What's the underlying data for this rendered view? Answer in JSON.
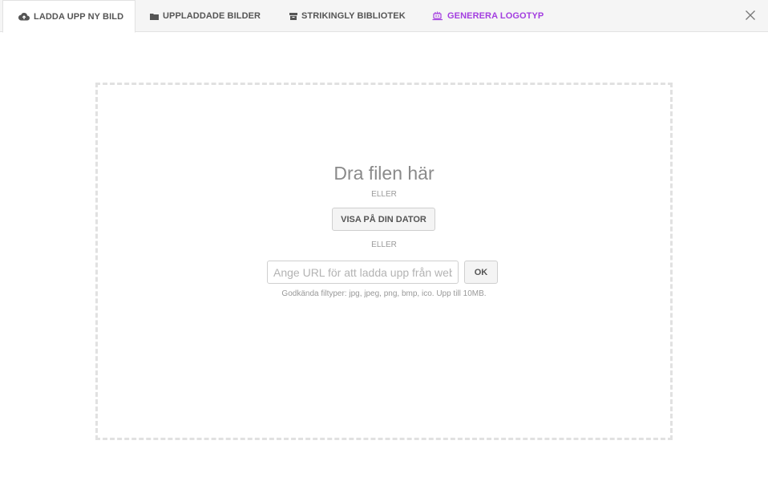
{
  "tabs": [
    {
      "label": "LADDA UPP NY BILD",
      "icon": "cloud-upload-icon",
      "active": true
    },
    {
      "label": "UPPLADDADE BILDER",
      "icon": "folder-icon",
      "active": false
    },
    {
      "label": "STRIKINGLY BIBLIOTEK",
      "icon": "archive-box-icon",
      "active": false
    },
    {
      "label": "GENERERA LOGOTYP",
      "icon": "logo-generator-icon",
      "active": false,
      "color": "#a33ee0"
    }
  ],
  "close_icon": "close-icon",
  "upload": {
    "drop_title": "Dra filen här",
    "or_1": "ELLER",
    "browse_label": "VISA PÅ DIN DATOR",
    "or_2": "ELLER",
    "url_placeholder": "Ange URL för att ladda upp från webben",
    "url_value": "",
    "ok_label": "OK",
    "hint": "Godkända filtyper: jpg, jpeg, png, bmp, ico. Upp till 10MB."
  },
  "colors": {
    "accent_purple": "#a33ee0",
    "dashed_border": "#e1e1e1"
  }
}
